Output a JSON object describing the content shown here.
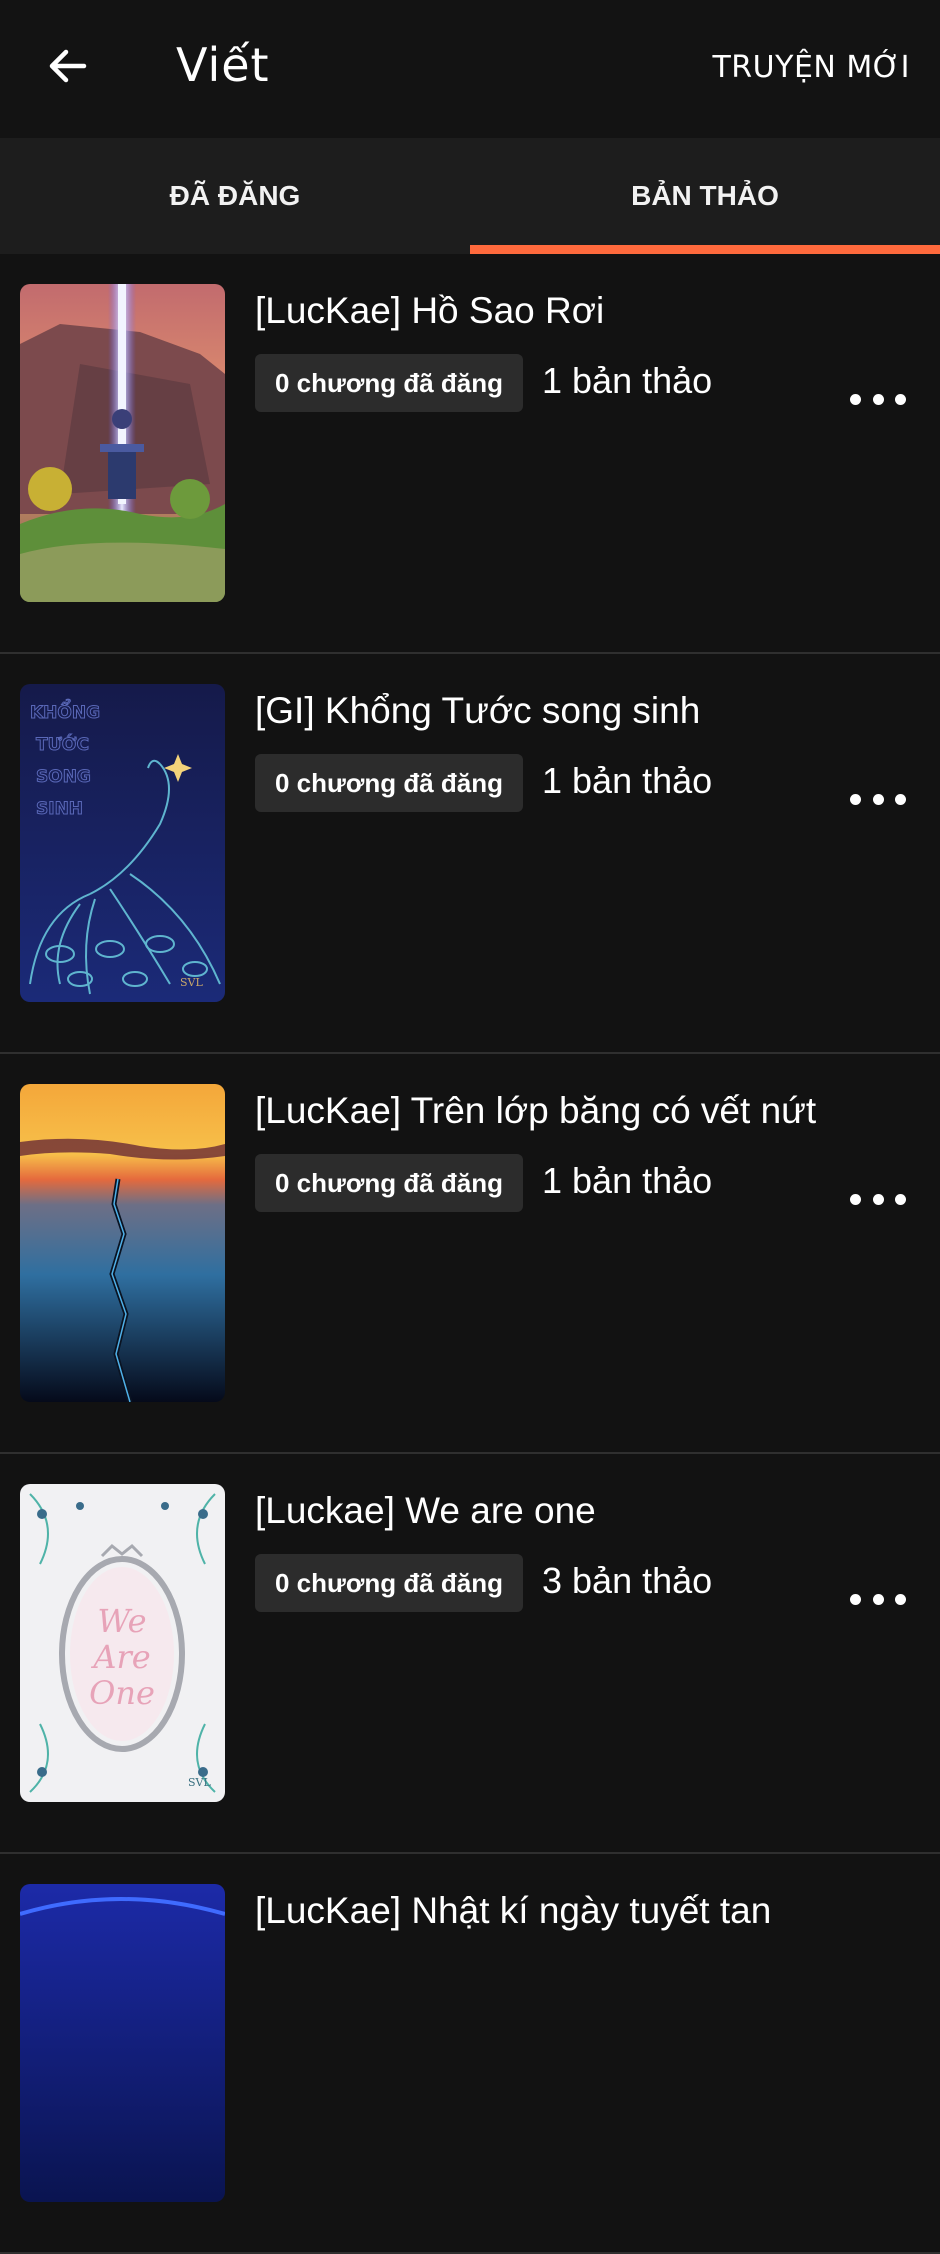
{
  "header": {
    "title": "Viết",
    "new_story": "TRUYỆN MỚI"
  },
  "tabs": [
    {
      "label": "ĐÃ ĐĂNG",
      "active": false
    },
    {
      "label": "BẢN THẢO",
      "active": true
    }
  ],
  "accent_color": "#ff6a3d",
  "stories": [
    {
      "title": "[LucKae] Hồ Sao Rơi",
      "published": "0 chương đã đăng",
      "drafts": "1 bản thảo"
    },
    {
      "title": "[GI] Khổng Tước song sinh",
      "published": "0 chương đã đăng",
      "drafts": "1 bản thảo",
      "cover_text": [
        "KHỔNG",
        "TƯỚC",
        "SONG",
        "SINH"
      ],
      "cover_mark": "SVL"
    },
    {
      "title": "[LucKae] Trên lớp băng có vết nứt",
      "published": "0 chương đã đăng",
      "drafts": "1 bản thảo"
    },
    {
      "title": "[Luckae] We are one",
      "published": "0 chương đã đăng",
      "drafts": "3 bản thảo",
      "cover_text": [
        "We",
        "Are",
        "One"
      ],
      "cover_mark": "SVL"
    },
    {
      "title": "[LucKae] Nhật kí ngày tuyết tan",
      "published": "",
      "drafts": ""
    }
  ]
}
